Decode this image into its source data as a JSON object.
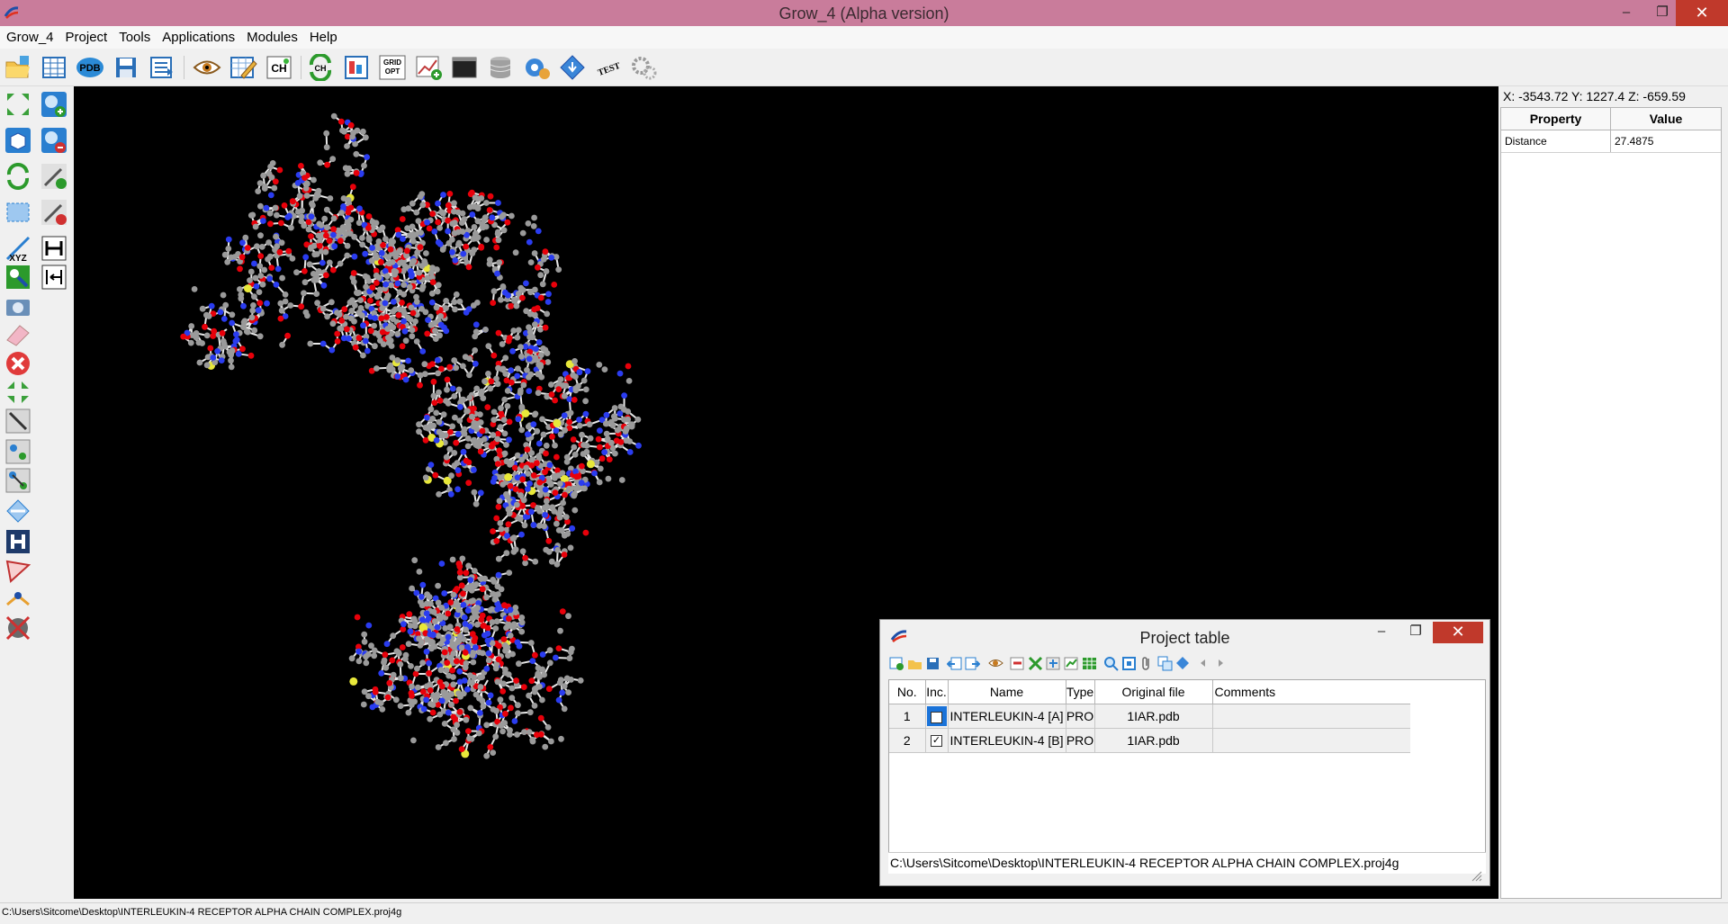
{
  "window": {
    "title": "Grow_4 (Alpha version)",
    "minimize": "–",
    "maximize": "❐",
    "close": "✕"
  },
  "menu": {
    "items": [
      "Grow_4",
      "Project",
      "Tools",
      "Applications",
      "Modules",
      "Help"
    ]
  },
  "toolbar": {
    "pdb_label": "PDB",
    "grid_opt_label_1": "GRID",
    "grid_opt_label_2": "OPT",
    "ch_label": "CH",
    "test_label": "TEST",
    "icons": [
      "open-folder-icon",
      "table-icon",
      "pdb-icon",
      "save-icon",
      "list-icon",
      "eye-icon",
      "edit-table-icon",
      "hydrogen-icon",
      "refresh-icon",
      "grid-icon",
      "grid-opt-icon",
      "chart-add-icon",
      "terminal-icon",
      "database-icon",
      "settings-gear-icon",
      "info-diamond-icon",
      "test-icon",
      "gears-icon"
    ]
  },
  "lefttools": {
    "xyz_label": "XYZ"
  },
  "rightpanel": {
    "coords": "X: -3543.72 Y: 1227.4 Z: -659.59",
    "columns": [
      "Property",
      "Value"
    ],
    "rows": [
      {
        "property": "Distance",
        "value": "27.4875"
      }
    ]
  },
  "project_table": {
    "title": "Project table",
    "columns": [
      "No.",
      "Inc.",
      "Name",
      "Type",
      "Original file",
      "Comments"
    ],
    "rows": [
      {
        "no": "1",
        "included": false,
        "selected": true,
        "name": "INTERLEUKIN-4 [A]",
        "type": "PRO",
        "file": "1IAR.pdb",
        "comments": ""
      },
      {
        "no": "2",
        "included": true,
        "selected": false,
        "name": "INTERLEUKIN-4 [B]",
        "type": "PRO",
        "file": "1IAR.pdb",
        "comments": ""
      }
    ],
    "path": "C:\\Users\\Sitcome\\Desktop\\INTERLEUKIN-4 RECEPTOR ALPHA CHAIN COMPLEX.proj4g",
    "checkmark": "✓"
  },
  "statusbar": {
    "text": "C:\\Users\\Sitcome\\Desktop\\INTERLEUKIN-4 RECEPTOR ALPHA CHAIN COMPLEX.proj4g"
  },
  "colors": {
    "titlebar": "#c97c9b",
    "carbon": "#9a9a9a",
    "oxygen": "#e8000a",
    "nitrogen": "#2a3cf0",
    "sulfur": "#e8e83a",
    "viewport_bg": "#000000"
  }
}
